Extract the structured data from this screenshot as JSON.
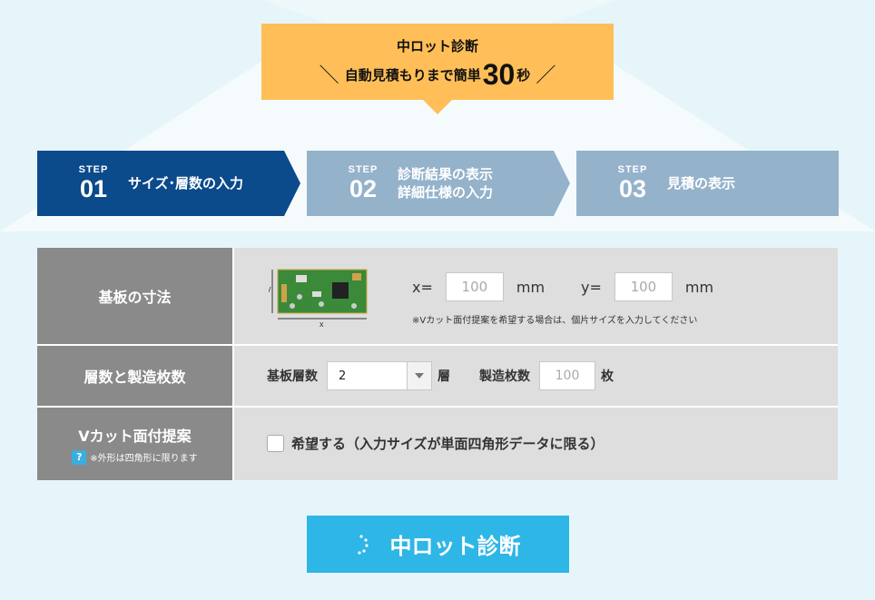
{
  "banner": {
    "title": "中ロット診断",
    "subtitle_pre": "自動見積もりまで簡単",
    "subtitle_num": "30",
    "subtitle_post": "秒",
    "slash_left": "＼",
    "slash_right": "／"
  },
  "steps": [
    {
      "step_word": "STEP",
      "number": "01",
      "label_line1": "サイズ･層数の入力",
      "label_line2": "",
      "active": true
    },
    {
      "step_word": "STEP",
      "number": "02",
      "label_line1": "診断結果の表示",
      "label_line2": "詳細仕様の入力",
      "active": false
    },
    {
      "step_word": "STEP",
      "number": "03",
      "label_line1": "見積の表示",
      "label_line2": "",
      "active": false
    }
  ],
  "form": {
    "size": {
      "header": "基板の寸法",
      "x_label": "x=",
      "x_placeholder": "100",
      "x_unit": "mm",
      "y_label": "y=",
      "y_placeholder": "100",
      "y_unit": "mm",
      "note": "※Vカット面付提案を希望する場合は、個片サイズを入力してください",
      "diagram_x": "x",
      "diagram_y": "y"
    },
    "layers": {
      "header": "層数と製造枚数",
      "layer_label": "基板層数",
      "layer_value": "2",
      "layer_unit": "層",
      "qty_label": "製造枚数",
      "qty_placeholder": "100",
      "qty_unit": "枚"
    },
    "vcut": {
      "header": "Vカット面付提案",
      "help_icon": "?",
      "header_note": "※外形は四角形に限ります",
      "checkbox_label": "希望する（入力サイズが単面四角形データに限る）"
    }
  },
  "cta": {
    "label": "中ロット診断"
  },
  "colors": {
    "active_step": "#0b4a8b",
    "inactive_step": "#95b2cb",
    "banner": "#ffbe57",
    "cta": "#2eb6e6"
  }
}
